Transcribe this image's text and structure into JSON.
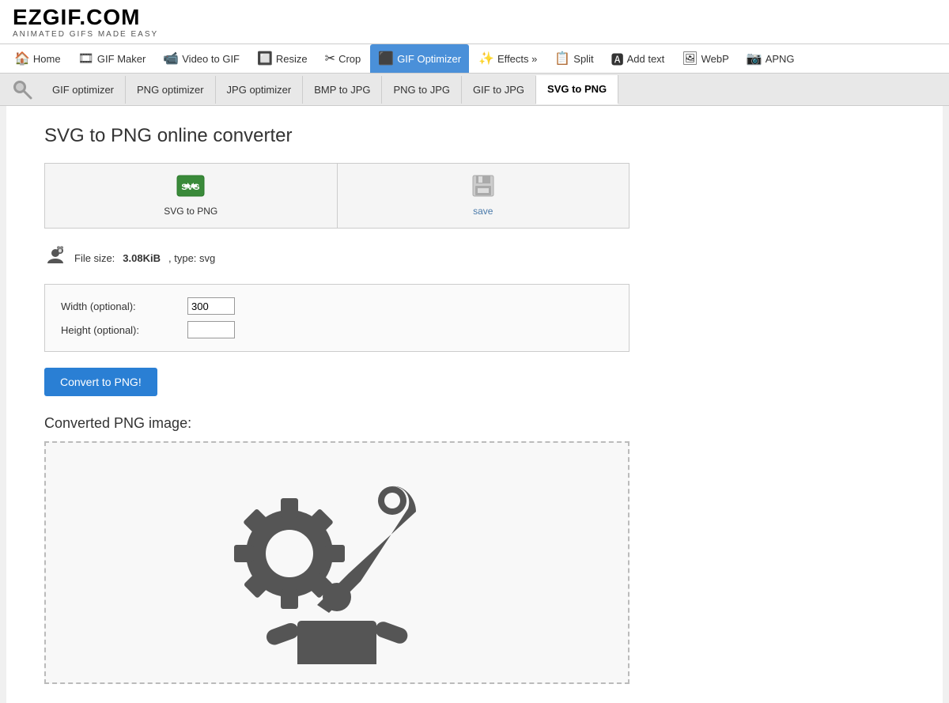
{
  "site": {
    "logo_main": "EZGIF.COM",
    "logo_sub": "Animated GIFs Made Easy"
  },
  "navbar": {
    "items": [
      {
        "id": "home",
        "label": "Home",
        "icon": "🏠",
        "active": false
      },
      {
        "id": "gif-maker",
        "label": "GIF Maker",
        "icon": "🎞",
        "active": false
      },
      {
        "id": "video-to-gif",
        "label": "Video to GIF",
        "icon": "📹",
        "active": false
      },
      {
        "id": "resize",
        "label": "Resize",
        "icon": "🔲",
        "active": false
      },
      {
        "id": "crop",
        "label": "Crop",
        "icon": "✂",
        "active": false
      },
      {
        "id": "gif-optimizer",
        "label": "GIF Optimizer",
        "icon": "⬛",
        "active": true
      },
      {
        "id": "effects",
        "label": "Effects »",
        "icon": "✨",
        "active": false
      },
      {
        "id": "split",
        "label": "Split",
        "icon": "📋",
        "active": false
      },
      {
        "id": "add-text",
        "label": "Add text",
        "icon": "🅰",
        "active": false
      },
      {
        "id": "webp",
        "label": "WebP",
        "icon": "🖼",
        "active": false
      },
      {
        "id": "apng",
        "label": "APNG",
        "icon": "📷",
        "active": false
      }
    ]
  },
  "subnav": {
    "items": [
      {
        "id": "gif-optimizer",
        "label": "GIF optimizer",
        "active": false
      },
      {
        "id": "png-optimizer",
        "label": "PNG optimizer",
        "active": false
      },
      {
        "id": "jpg-optimizer",
        "label": "JPG optimizer",
        "active": false
      },
      {
        "id": "bmp-to-jpg",
        "label": "BMP to JPG",
        "active": false
      },
      {
        "id": "png-to-jpg",
        "label": "PNG to JPG",
        "active": false
      },
      {
        "id": "gif-to-jpg",
        "label": "GIF to JPG",
        "active": false
      },
      {
        "id": "svg-to-png",
        "label": "SVG to PNG",
        "active": true
      }
    ]
  },
  "page": {
    "title": "SVG to PNG online converter",
    "tool_btn_svg_label": "SVG to PNG",
    "tool_btn_save_label": "save",
    "file_size_label": "File size:",
    "file_size_value": "3.08KiB",
    "file_type_label": ", type: svg",
    "width_label": "Width (optional):",
    "width_value": "300",
    "height_label": "Height (optional):",
    "height_value": "",
    "convert_btn_label": "Convert to PNG!",
    "converted_label": "Converted PNG image:"
  }
}
